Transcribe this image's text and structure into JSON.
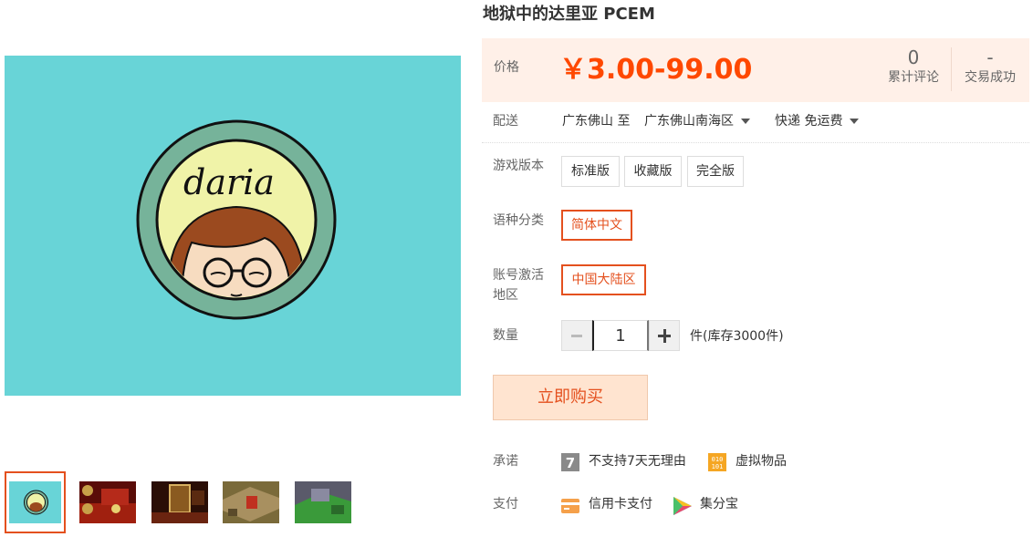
{
  "product": {
    "title": "地狱中的达里亚 PCEM",
    "main_image_text": "daria"
  },
  "price": {
    "label": "价格",
    "value": "￥3.00-99.00",
    "color": "#ff4800"
  },
  "stats": [
    {
      "num": "0",
      "label": "累计评论"
    },
    {
      "num": "-",
      "label": "交易成功"
    }
  ],
  "shipping": {
    "label": "配送",
    "from": "广东佛山 至",
    "to": "广东佛山南海区",
    "method": "快递 免运费"
  },
  "game_version": {
    "label": "游戏版本",
    "options": [
      "标准版",
      "收藏版",
      "完全版"
    ]
  },
  "language": {
    "label": "语种分类",
    "selected": "简体中文"
  },
  "region": {
    "label_line1": "账号激活",
    "label_line2": "地区",
    "selected": "中国大陆区"
  },
  "quantity": {
    "label": "数量",
    "value": "1",
    "stock": "件(库存3000件)"
  },
  "buy_button": "立即购买",
  "promise": {
    "label": "承诺",
    "items": [
      {
        "icon": "seven-days-icon",
        "text": "不支持7天无理由"
      },
      {
        "icon": "virtual-goods-icon",
        "text": "虚拟物品"
      }
    ]
  },
  "payment": {
    "label": "支付",
    "items": [
      {
        "icon": "credit-card-icon",
        "text": "信用卡支付"
      },
      {
        "icon": "jifenbao-icon",
        "text": "集分宝"
      }
    ]
  },
  "colors": {
    "accent": "#e4501e",
    "price_bg": "#fff0e8",
    "image_bg": "#68d4d7"
  }
}
